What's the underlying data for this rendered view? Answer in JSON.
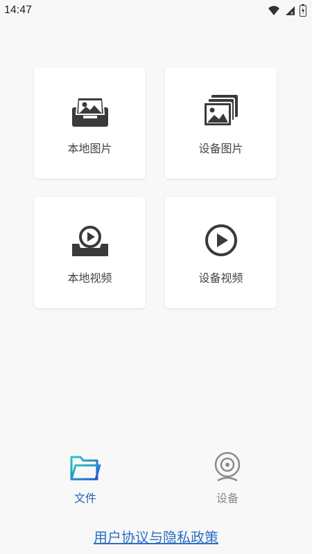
{
  "status_bar": {
    "time": "14:47"
  },
  "grid": {
    "items": [
      {
        "label": "本地图片",
        "icon": "local-image-icon"
      },
      {
        "label": "设备图片",
        "icon": "device-image-icon"
      },
      {
        "label": "本地视频",
        "icon": "local-video-icon"
      },
      {
        "label": "设备视频",
        "icon": "device-video-icon"
      }
    ]
  },
  "tabs": [
    {
      "label": "文件",
      "icon": "folder-icon",
      "active": true,
      "color": "#1f5fb3"
    },
    {
      "label": "设备",
      "icon": "camera-icon",
      "active": false,
      "color": "#8a8a8a"
    }
  ],
  "footer": {
    "privacy_label": "用户协议与隐私政策"
  },
  "colors": {
    "background": "#f8f8f8",
    "card": "#ffffff",
    "icon": "#3a3a3a",
    "link": "#2c6fc4"
  }
}
